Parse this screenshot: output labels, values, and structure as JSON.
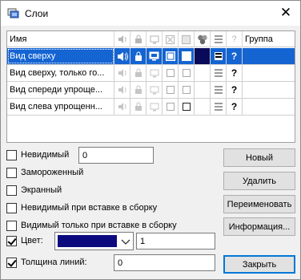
{
  "window": {
    "title": "Слои",
    "close_glyph": "✕"
  },
  "grid": {
    "headers": {
      "name": "Имя",
      "group": "Группа",
      "help": "?"
    },
    "rows": [
      {
        "name": "Вид сверху",
        "selected": true,
        "color": "#0a0a5a"
      },
      {
        "name": "Вид сверху, только го...",
        "selected": false
      },
      {
        "name": "Вид спереди упроще...",
        "selected": false
      },
      {
        "name": "Вид слева упрощенн...",
        "selected": false
      }
    ]
  },
  "options": {
    "invisible": {
      "label": "Невидимый",
      "checked": false,
      "value": "0"
    },
    "frozen": {
      "label": "Замороженный",
      "checked": false
    },
    "screen": {
      "label": "Экранный",
      "checked": false
    },
    "invisible_on_insert": {
      "label": "Невидимый при вставке в сборку",
      "checked": false
    },
    "visible_only_on_insert": {
      "label": "Видимый только при вставке в сборку",
      "checked": false
    },
    "color": {
      "label": "Цвет:",
      "checked": true,
      "swatch": "#0a0a7e",
      "value": "1"
    },
    "line_width": {
      "label": "Толщина линий:",
      "checked": true,
      "value": "0"
    }
  },
  "buttons": {
    "new": "Новый",
    "delete": "Удалить",
    "rename": "Переименовать",
    "info": "Информация...",
    "close": "Закрыть"
  },
  "accent_color": "#1464d2"
}
